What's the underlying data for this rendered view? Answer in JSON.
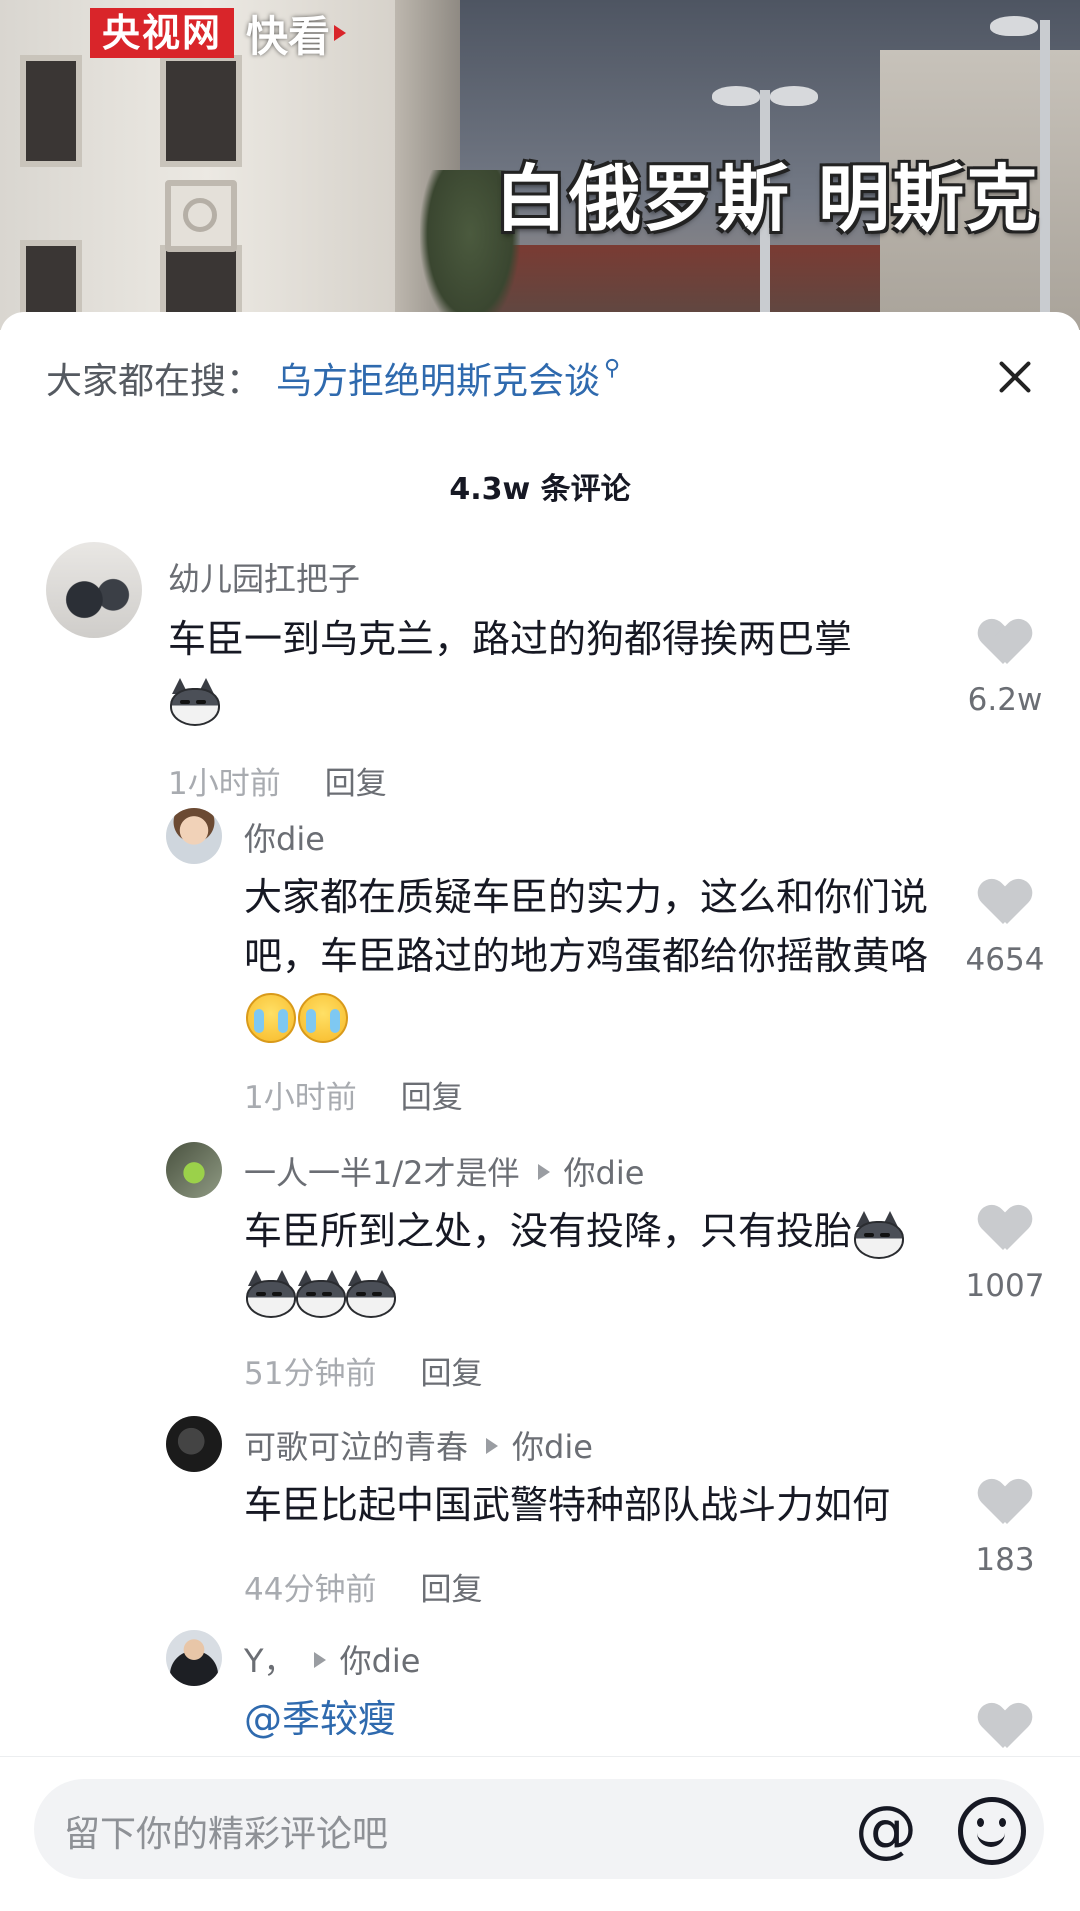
{
  "video": {
    "logo_red": "央视网",
    "logo_white": "快看",
    "caption": "白俄罗斯  明斯克"
  },
  "sheet": {
    "hot_label": "大家都在搜：",
    "hot_term": "乌方拒绝明斯克会谈",
    "comment_count": "4.3w 条评论"
  },
  "comments": [
    {
      "user": "幼儿园扛把子",
      "text": "车臣一到乌克兰，路过的狗都得挨两巴掌",
      "emojis": [
        "husky"
      ],
      "time": "1小时前",
      "reply_label": "回复",
      "likes": "6.2w"
    },
    {
      "user": "你die",
      "text": "大家都在质疑车臣的实力，这么和你们说吧，车臣路过的地方鸡蛋都给你摇散黄咯",
      "emojis": [
        "cry",
        "cry"
      ],
      "time": "1小时前",
      "reply_label": "回复",
      "likes": "4654"
    },
    {
      "user": "一人一半1/2才是伴",
      "reply_to": "你die",
      "text": "车臣所到之处，没有投降，只有投胎",
      "emojis": [
        "husky",
        "husky",
        "husky",
        "husky"
      ],
      "time": "51分钟前",
      "reply_label": "回复",
      "likes": "1007"
    },
    {
      "user": "可歌可泣的青春",
      "reply_to": "你die",
      "text": "车臣比起中国武警特种部队战斗力如何",
      "time": "44分钟前",
      "reply_label": "回复",
      "likes": "183"
    },
    {
      "user": "Y，",
      "reply_to": "你die",
      "text": "@季较瘦"
    }
  ],
  "input": {
    "placeholder": "留下你的精彩评论吧",
    "at_symbol": "@"
  },
  "colors": {
    "link": "#2f6aae",
    "brand_red": "#d9252a",
    "meta_gray": "#a8abb0"
  }
}
